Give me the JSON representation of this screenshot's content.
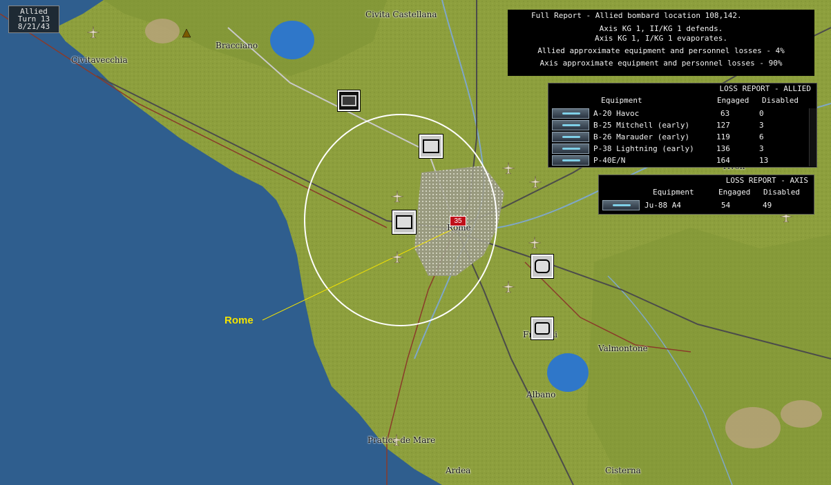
{
  "turn_box": {
    "side": "Allied",
    "turn": "Turn 13",
    "date": "8/21/43"
  },
  "full_report": {
    "header": "Full Report -  Allied bombard location 108,142.",
    "lines": [
      "Axis KG 1, II/KG 1 defends.",
      "Axis KG 1, I/KG 1 evaporates.",
      "Allied approximate equipment and personnel losses - 4%",
      "Axis approximate equipment and personnel losses - 90%"
    ]
  },
  "allied_loss": {
    "title": "LOSS REPORT -  ALLIED",
    "col_equipment": "Equipment",
    "col_engaged": "Engaged",
    "col_disabled": "Disabled",
    "rows": [
      {
        "name": "A-20 Havoc",
        "engaged": "63",
        "disabled": "0"
      },
      {
        "name": "B-25 Mitchell (early)",
        "engaged": "127",
        "disabled": "3"
      },
      {
        "name": "B-26 Marauder (early)",
        "engaged": "119",
        "disabled": "6"
      },
      {
        "name": "P-38 Lightning (early)",
        "engaged": "136",
        "disabled": "3"
      },
      {
        "name": "P-40E/N",
        "engaged": "164",
        "disabled": "13"
      }
    ]
  },
  "axis_loss": {
    "title": "LOSS REPORT -  AXIS",
    "col_equipment": "Equipment",
    "col_engaged": "Engaged",
    "col_disabled": "Disabled",
    "rows": [
      {
        "name": "Ju-88 A4",
        "engaged": "54",
        "disabled": "49"
      }
    ]
  },
  "map": {
    "towns": {
      "civita_castellana": "Civita Castellana",
      "bracciano": "Bracciano",
      "civitavecchia": "Civitavecchia",
      "rome": "Rome",
      "tivoli": "Tivoli",
      "frascati": "Frascati",
      "valmontone": "Valmontone",
      "albano": "Albano",
      "pratica": "Pratica de Mare",
      "ardea": "Ardea",
      "cisterna": "Cisterna"
    },
    "rome_callout": "Rome",
    "hex_number": "35"
  },
  "colors": {
    "sea": "#2f5e8e",
    "land": "#8fa23e",
    "report_bg": "#000000",
    "callout": "#f5e400",
    "road": "#8a3a2a"
  }
}
